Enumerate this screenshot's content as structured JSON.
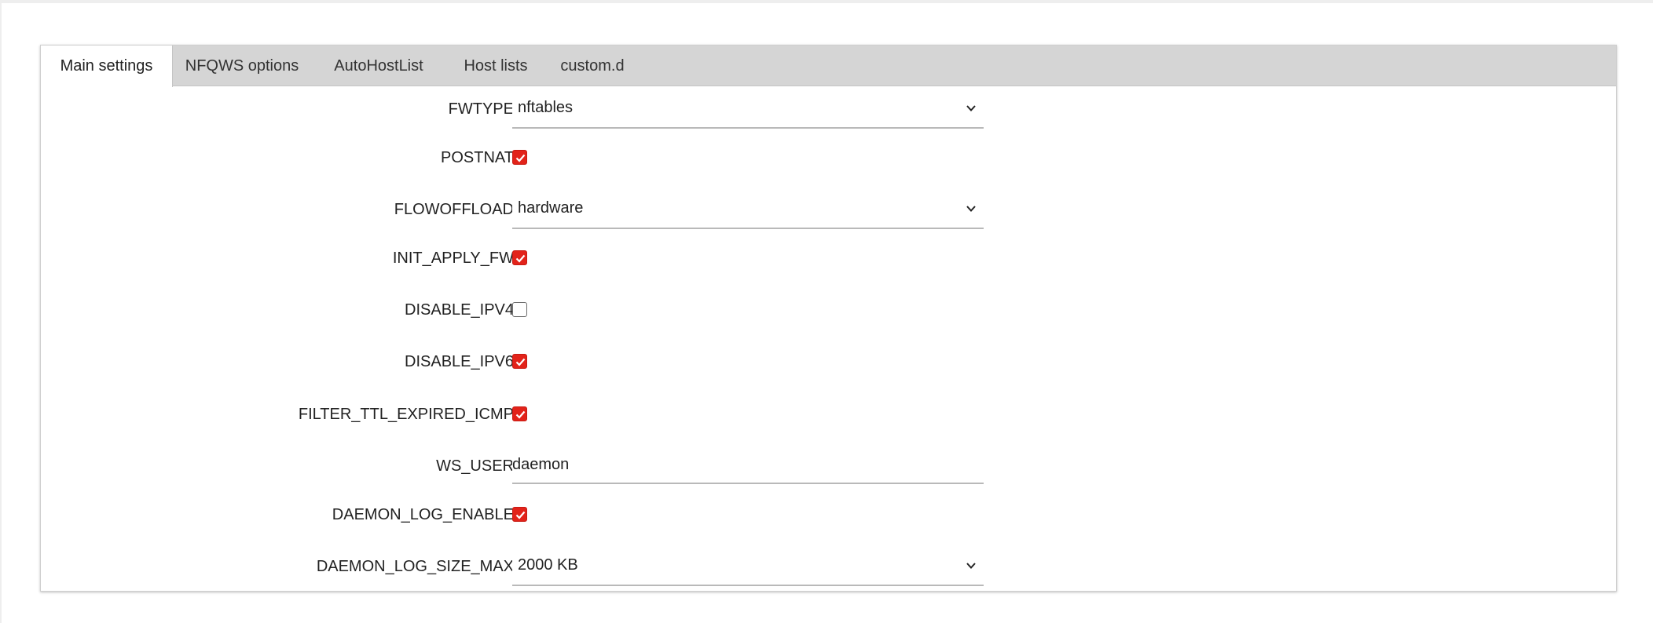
{
  "tabs": [
    {
      "label": "Main settings",
      "active": true
    },
    {
      "label": "NFQWS options",
      "active": false
    },
    {
      "label": "AutoHostList",
      "active": false
    },
    {
      "label": "Host lists",
      "active": false
    },
    {
      "label": "custom.d",
      "active": false
    }
  ],
  "settings": {
    "fwtype": {
      "label": "FWTYPE",
      "value": "nftables"
    },
    "postnat": {
      "label": "POSTNAT",
      "checked": true
    },
    "flowoffload": {
      "label": "FLOWOFFLOAD",
      "value": "hardware"
    },
    "init_apply_fw": {
      "label": "INIT_APPLY_FW",
      "checked": true
    },
    "disable_ipv4": {
      "label": "DISABLE_IPV4",
      "checked": false
    },
    "disable_ipv6": {
      "label": "DISABLE_IPV6",
      "checked": true
    },
    "filter_ttl_expired_icmp": {
      "label": "FILTER_TTL_EXPIRED_ICMP",
      "checked": true
    },
    "ws_user": {
      "label": "WS_USER",
      "value": "daemon"
    },
    "daemon_log_enable": {
      "label": "DAEMON_LOG_ENABLE",
      "checked": true
    },
    "daemon_log_size_max": {
      "label": "DAEMON_LOG_SIZE_MAX",
      "value": "2000 KB"
    }
  },
  "icons": {
    "select_arrow": "chevron-down-icon",
    "checkbox_mark": "checkmark-icon"
  },
  "colors": {
    "accent": "#e2231a",
    "tabbar": "#d5d5d5",
    "underline": "#b9b9b9"
  }
}
